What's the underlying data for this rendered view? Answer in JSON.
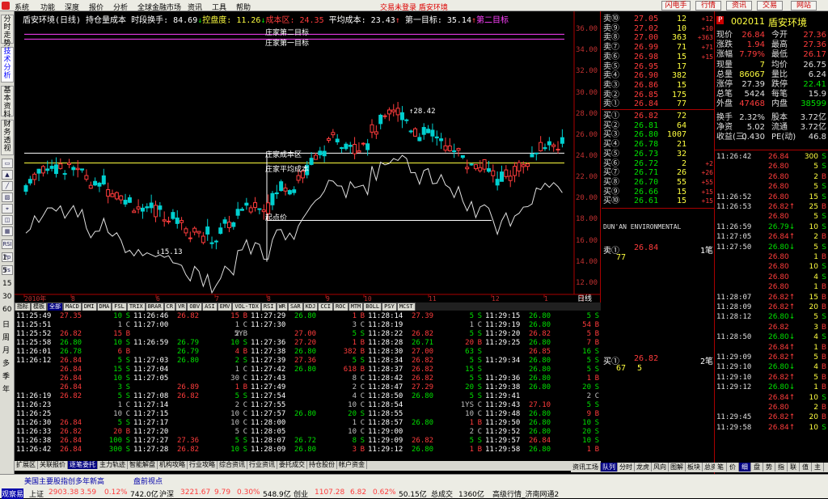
{
  "menu": {
    "items": [
      "系统",
      "功能",
      "深度",
      "报价",
      "分析",
      "全球金融市场",
      "资讯",
      "工具",
      "帮助"
    ],
    "center": "交易未登录  盾安环境",
    "right_buttons": [
      "闪电手",
      "行情",
      "资讯",
      "交易",
      "网站"
    ]
  },
  "left_tabs": [
    "分时走势",
    "技术分析",
    "基本资料",
    "财务透视"
  ],
  "left_buttons": [
    "RSI",
    "Pp",
    "Fs"
  ],
  "left_nums": [
    "1",
    "5",
    "15",
    "30",
    "60",
    "日",
    "周",
    "月",
    "多",
    "季",
    "年"
  ],
  "chart": {
    "head": [
      {
        "t": "盾安环境(日线) 持仓量成本 时段换手: ",
        "c": "white"
      },
      {
        "t": "84.69",
        "c": "white"
      },
      {
        "t": "↓",
        "c": "green"
      },
      {
        "t": "控盘度: ",
        "c": "yellow"
      },
      {
        "t": "11.26",
        "c": "yellow"
      },
      {
        "t": "↓",
        "c": "green"
      },
      {
        "t": "成本区: 24.35 ",
        "c": "red"
      },
      {
        "t": "平均成本: ",
        "c": "white"
      },
      {
        "t": "23.43",
        "c": "white"
      },
      {
        "t": "↑",
        "c": "red"
      },
      {
        "t": " 第一目标: ",
        "c": "white"
      },
      {
        "t": "35.14",
        "c": "white"
      },
      {
        "t": "↑",
        "c": "red"
      },
      {
        "t": "第二目标",
        "c": "mag"
      }
    ],
    "labels": {
      "target2": "庄家第二目标",
      "target1": "庄家第一目标",
      "cost_zone": "庄家成本区",
      "avg_cost": "庄家平均成本",
      "start": "起点价",
      "high": "28.42",
      "low": "15.13"
    },
    "yticks": [
      "36.00",
      "34.00",
      "32.00",
      "30.00",
      "28.00",
      "26.00",
      "24.00",
      "22.00",
      "20.00",
      "18.00",
      "16.00",
      "14.00",
      "12.00"
    ],
    "xticks": [
      "2010年",
      "8",
      "6",
      "7",
      "8",
      "9",
      "10",
      "11",
      "12",
      "1",
      "2"
    ],
    "period_label": "日线"
  },
  "chart_data": {
    "type": "candlestick",
    "title": "盾安环境(日线) 持仓量成本",
    "ylim": [
      11,
      37
    ],
    "yticks": [
      36,
      34,
      32,
      30,
      28,
      26,
      24,
      22,
      20,
      18,
      16,
      14,
      12
    ],
    "high": 28.42,
    "low": 15.13,
    "levels": {
      "第一目标": 35.14,
      "成本区": 24.35,
      "平均成本": 23.43
    }
  },
  "indicator_tabs": [
    "指标",
    "模板",
    "全部",
    "MACD",
    "DMI",
    "DMA",
    "FSL",
    "TRIX",
    "BRAR",
    "CR",
    "VR",
    "OBV",
    "ASI",
    "EMV",
    "VOL-TDX",
    "RSI",
    "WR",
    "SAR",
    "KDJ",
    "CCI",
    "ROC",
    "MTM",
    "BOLL",
    "PSY",
    "MCST"
  ],
  "ticks": [
    [
      [
        "11:25:49",
        "27.35",
        "10",
        "S"
      ],
      [
        "11:25:51",
        "",
        "1",
        "C"
      ],
      [
        "11:25:52",
        "26.82",
        "15",
        "B"
      ],
      [
        "11:25:58",
        "26.80",
        "10",
        "S"
      ],
      [
        "11:26:01",
        "26.78",
        "6",
        "B"
      ],
      [
        "11:26:12",
        "26.84",
        "5",
        "S"
      ],
      [
        "",
        "26.84",
        "15",
        "S"
      ],
      [
        "",
        "26.84",
        "10",
        "S"
      ],
      [
        "",
        "26.84",
        "3",
        "S"
      ],
      [
        "11:26:19",
        "26.82",
        "5",
        "S"
      ],
      [
        "11:26:23",
        "",
        "1",
        "C"
      ],
      [
        "11:26:25",
        "",
        "10",
        "C"
      ],
      [
        "11:26:30",
        "26.84",
        "5",
        "S"
      ],
      [
        "11:26:33",
        "26.82",
        "20",
        "B"
      ],
      [
        "11:26:38",
        "26.84",
        "100",
        "S"
      ],
      [
        "11:26:42",
        "26.84",
        "300",
        "S"
      ]
    ],
    [
      [
        "11:26:46",
        "26.82",
        "15",
        "B"
      ],
      [
        "11:27:00",
        "",
        "1",
        "C"
      ],
      [
        "",
        "",
        "2",
        "5YB"
      ],
      [
        "11:26:59",
        "26.79",
        "10",
        "S"
      ],
      [
        "",
        "26.79",
        "4",
        "B"
      ],
      [
        "11:27:03",
        "26.80",
        "2",
        "S"
      ],
      [
        "11:27:04",
        "",
        "1",
        "C"
      ],
      [
        "11:27:05",
        "",
        "30",
        "C"
      ],
      [
        "",
        "26.89",
        "1",
        "B"
      ],
      [
        "11:27:08",
        "26.82",
        "5",
        "S"
      ],
      [
        "11:27:14",
        "",
        "2",
        "C"
      ],
      [
        "11:27:15",
        "",
        "10",
        "C"
      ],
      [
        "11:27:17",
        "",
        "10",
        "C"
      ],
      [
        "11:27:20",
        "",
        "5",
        "C"
      ],
      [
        "11:27:27",
        "27.36",
        "5",
        "S"
      ],
      [
        "11:27:28",
        "26.82",
        "10",
        "S"
      ]
    ],
    [
      [
        "11:27:29",
        "26.80",
        "1",
        "B"
      ],
      [
        "11:27:30",
        "",
        "3",
        "C"
      ],
      [
        "",
        "27.00",
        "5",
        "S"
      ],
      [
        "11:27:36",
        "27.20",
        "1",
        "B"
      ],
      [
        "11:27:38",
        "26.80",
        "382",
        "B"
      ],
      [
        "11:27:39",
        "27.36",
        "5",
        "S"
      ],
      [
        "11:27:42",
        "26.80",
        "618",
        "B"
      ],
      [
        "11:27:43",
        "",
        "8",
        "C"
      ],
      [
        "11:27:49",
        "",
        "2",
        "C"
      ],
      [
        "11:27:54",
        "",
        "4",
        "C"
      ],
      [
        "11:27:55",
        "",
        "10",
        "C"
      ],
      [
        "11:27:57",
        "26.80",
        "20",
        "S"
      ],
      [
        "11:28:00",
        "",
        "1",
        "C"
      ],
      [
        "11:28:05",
        "",
        "10",
        "C"
      ],
      [
        "11:28:07",
        "26.72",
        "8",
        "S"
      ],
      [
        "11:28:09",
        "26.80",
        "3",
        "B"
      ]
    ],
    [
      [
        "11:28:14",
        "27.39",
        "5",
        "S"
      ],
      [
        "11:28:19",
        "",
        "1",
        "C"
      ],
      [
        "11:28:22",
        "26.82",
        "5",
        "S"
      ],
      [
        "11:28:28",
        "26.71",
        "20",
        "B"
      ],
      [
        "11:28:30",
        "27.00",
        "63",
        "S"
      ],
      [
        "11:28:34",
        "26.82",
        "5",
        "S"
      ],
      [
        "11:28:37",
        "26.82",
        "15",
        "S"
      ],
      [
        "11:28:42",
        "26.82",
        "5",
        "S"
      ],
      [
        "11:28:47",
        "27.29",
        "20",
        "S"
      ],
      [
        "11:28:50",
        "26.80",
        "5",
        "S"
      ],
      [
        "11:28:54",
        "",
        "1YS",
        "C"
      ],
      [
        "11:28:55",
        "",
        "10",
        "C"
      ],
      [
        "11:28:57",
        "26.80",
        "1",
        "B"
      ],
      [
        "11:29:00",
        "",
        "2",
        "C"
      ],
      [
        "11:29:09",
        "26.82",
        "5",
        "S"
      ],
      [
        "11:29:12",
        "26.80",
        "1",
        "B"
      ]
    ],
    [
      [
        "11:29:15",
        "26.80",
        "5",
        "S"
      ],
      [
        "11:29:19",
        "26.80",
        "54",
        "B"
      ],
      [
        "11:29:20",
        "26.82",
        "5",
        "B"
      ],
      [
        "11:29:25",
        "26.80",
        "7",
        "B"
      ],
      [
        "",
        "26.85",
        "16",
        "S"
      ],
      [
        "11:29:34",
        "26.80",
        "5",
        "S"
      ],
      [
        "",
        "26.80",
        "5",
        "S"
      ],
      [
        "11:29:36",
        "26.80",
        "1",
        "B"
      ],
      [
        "11:29:38",
        "26.80",
        "20",
        "S"
      ],
      [
        "11:29:41",
        "",
        "2",
        "C"
      ],
      [
        "11:29:43",
        "27.10",
        "5",
        "S"
      ],
      [
        "11:29:48",
        "26.80",
        "9",
        "B"
      ],
      [
        "11:29:50",
        "26.80",
        "10",
        "S"
      ],
      [
        "11:29:52",
        "26.80",
        "20",
        "S"
      ],
      [
        "11:29:57",
        "26.84",
        "10",
        "S"
      ],
      [
        "11:29:58",
        "26.80",
        "1",
        "B"
      ]
    ]
  ],
  "bottom_tabs": [
    "扩展区",
    "关联报价",
    "逐笔委托",
    "主力轨迹",
    "智能解盘",
    "机构攻略",
    "行业攻略",
    "综合资讯",
    "行业资讯",
    "委托成交",
    "持仓股份",
    "帐户资金"
  ],
  "orderbook": {
    "sell": [
      [
        "卖⑩",
        "27.05",
        "12",
        "+12"
      ],
      [
        "卖⑨",
        "27.02",
        "10",
        "+10"
      ],
      [
        "卖⑧",
        "27.00",
        "363",
        "+363"
      ],
      [
        "卖⑦",
        "26.99",
        "71",
        "+71"
      ],
      [
        "卖⑥",
        "26.98",
        "15",
        "+15"
      ],
      [
        "卖⑤",
        "26.95",
        "17",
        ""
      ],
      [
        "卖④",
        "26.90",
        "382",
        ""
      ],
      [
        "卖③",
        "26.86",
        "15",
        ""
      ],
      [
        "卖②",
        "26.85",
        "175",
        ""
      ],
      [
        "卖①",
        "26.84",
        "77",
        ""
      ]
    ],
    "buy": [
      [
        "买①",
        "26.82",
        "72",
        ""
      ],
      [
        "买②",
        "26.81",
        "64",
        ""
      ],
      [
        "买③",
        "26.80",
        "1007",
        ""
      ],
      [
        "买④",
        "26.78",
        "21",
        ""
      ],
      [
        "买⑤",
        "26.73",
        "32",
        ""
      ],
      [
        "买⑥",
        "26.72",
        "2",
        "+2"
      ],
      [
        "买⑦",
        "26.71",
        "26",
        "+26"
      ],
      [
        "买⑧",
        "26.70",
        "55",
        "+55"
      ],
      [
        "买⑨",
        "26.66",
        "15",
        "+15"
      ],
      [
        "买⑩",
        "26.61",
        "15",
        "+15"
      ]
    ],
    "name_en": "DUN'AN ENVIRONMENTAL",
    "sell1_label": "卖①",
    "sell1_price": "26.84",
    "sell1_count": "1笔",
    "sell1_vol": "77",
    "buy1_label": "买①",
    "buy1_price": "26.82",
    "buy1_count": "2笔",
    "buy1_vols": [
      "67",
      "5"
    ],
    "side_tabs": [
      "资讯工场",
      "队列",
      "分时",
      "龙虎",
      "风向",
      "图解",
      "板块",
      "总资"
    ]
  },
  "quote": {
    "code": "002011",
    "name": "盾安环境",
    "rows": [
      [
        "现价",
        "26.84",
        "今开",
        "27.36"
      ],
      [
        "涨跌",
        "1.94",
        "最高",
        "27.36"
      ],
      [
        "涨幅",
        "7.79%",
        "最低",
        "26.17"
      ],
      [
        "现量",
        "7",
        "均价",
        "26.75"
      ],
      [
        "总量",
        "86067",
        "量比",
        "6.24"
      ],
      [
        "涨停",
        "27.39",
        "跌停",
        "22.41"
      ],
      [
        "总笔",
        "5424",
        "每笔",
        "15.9"
      ],
      [
        "外盘",
        "47468",
        "内盘",
        "38599"
      ],
      [
        "换手",
        "2.32%",
        "股本",
        "3.72亿"
      ],
      [
        "净资",
        "5.02",
        "流通",
        "3.72亿"
      ],
      [
        "收益(三)",
        "0.430",
        "PE(动)",
        "46.8"
      ]
    ],
    "ticks": [
      [
        "11:26:42",
        "26.84",
        "300",
        "S"
      ],
      [
        "",
        "26.80",
        "5",
        "S"
      ],
      [
        "",
        "26.80",
        "2",
        "B"
      ],
      [
        "",
        "26.80",
        "5",
        "S"
      ],
      [
        "11:26:52",
        "26.80",
        "15",
        "S"
      ],
      [
        "11:26:53",
        "26.82↑",
        "25",
        "B"
      ],
      [
        "",
        "26.80",
        "5",
        "S"
      ],
      [
        "11:26:59",
        "26.79↓",
        "10",
        "S"
      ],
      [
        "11:27:05",
        "26.84↑",
        "2",
        "B"
      ],
      [
        "11:27:50",
        "26.80↓",
        "5",
        "S"
      ],
      [
        "",
        "26.80",
        "1",
        "B"
      ],
      [
        "",
        "26.80",
        "10",
        "S"
      ],
      [
        "",
        "26.80",
        "4",
        "S"
      ],
      [
        "",
        "26.80",
        "1",
        "B"
      ],
      [
        "11:28:07",
        "26.82↑",
        "15",
        "B"
      ],
      [
        "11:28:09",
        "26.82↑",
        "20",
        "B"
      ],
      [
        "11:28:12",
        "26.80↓",
        "5",
        "S"
      ],
      [
        "",
        "26.82",
        "3",
        "B"
      ],
      [
        "11:28:50",
        "26.80↓",
        "4",
        "S"
      ],
      [
        "",
        "26.84↑",
        "1",
        "B"
      ],
      [
        "11:29:09",
        "26.82↑",
        "5",
        "B"
      ],
      [
        "11:29:10",
        "26.80↓",
        "4",
        "B"
      ],
      [
        "11:29:10",
        "26.82↑",
        "5",
        "B"
      ],
      [
        "11:29:12",
        "26.80↓",
        "1",
        "B"
      ],
      [
        "",
        "26.84↑",
        "10",
        "S"
      ],
      [
        "",
        "26.80",
        "2",
        "B"
      ],
      [
        "11:29:45",
        "26.82↑",
        "20",
        "B"
      ],
      [
        "11:29:58",
        "26.84↑",
        "10",
        "S"
      ]
    ],
    "tabs": [
      "笔",
      "价",
      "细",
      "盘",
      "势",
      "指",
      "联",
      "值",
      "主"
    ]
  },
  "status": {
    "news": [
      "美国主要股指创多年新高",
      "盘前视点"
    ],
    "row": [
      [
        "观察易",
        "red"
      ],
      [
        "上证",
        "black"
      ],
      [
        "2903.38",
        "red"
      ],
      [
        "3.59",
        "red"
      ],
      [
        "0.12%",
        "red"
      ],
      [
        "742.0亿",
        "black"
      ],
      [
        "沪深",
        "black"
      ],
      [
        "3221.67",
        "red"
      ],
      [
        "9.79",
        "red"
      ],
      [
        "0.30%",
        "red"
      ],
      [
        "548.9亿",
        "black"
      ],
      [
        "创业",
        "black"
      ],
      [
        "1107.28",
        "red"
      ],
      [
        "6.82",
        "red"
      ],
      [
        "0.62%",
        "red"
      ],
      [
        "50.15亿",
        "black"
      ],
      [
        "总成交",
        "black"
      ],
      [
        "1360亿",
        "black"
      ],
      [
        "高级行情_济南网通2",
        "black"
      ]
    ]
  }
}
